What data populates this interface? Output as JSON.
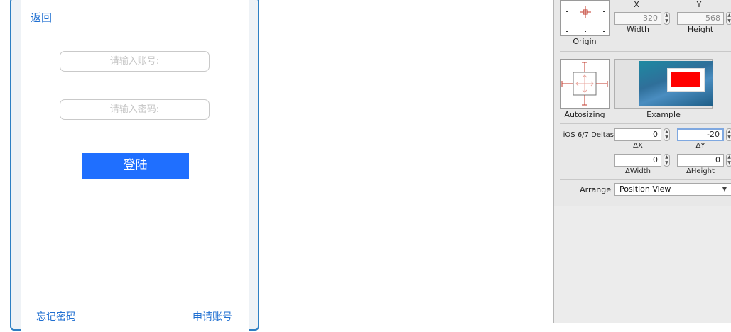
{
  "app": {
    "back_label": "返回",
    "account_placeholder": "请输入账号:",
    "password_placeholder": "请输入密码:",
    "login_label": "登陆",
    "forgot_label": "忘记密码",
    "apply_label": "申请账号"
  },
  "inspector": {
    "x_label": "X",
    "y_label": "Y",
    "x_value": "320",
    "y_value": "568",
    "width_label": "Width",
    "height_label": "Height",
    "origin_label": "Origin",
    "autosizing_label": "Autosizing",
    "example_label": "Example",
    "deltas_label": "iOS 6/7 Deltas",
    "dx_value": "0",
    "dy_value": "-20",
    "dx_label": "ΔX",
    "dy_label": "ΔY",
    "dwidth_value": "0",
    "dheight_value": "0",
    "dwidth_label": "ΔWidth",
    "dheight_label": "ΔHeight",
    "arrange_label": "Arrange",
    "arrange_value": "Position View"
  },
  "colors": {
    "accent_blue": "#1f6fd1",
    "button_blue": "#1f6fff",
    "device_border": "#2d7fc3",
    "strut_red": "#c0392b"
  },
  "icons": {
    "origin": "crosshair-icon",
    "autosize": "strut-spring-icon",
    "stepper": "stepper-arrows-icon",
    "dropdown": "dropdown-arrow-icon"
  }
}
